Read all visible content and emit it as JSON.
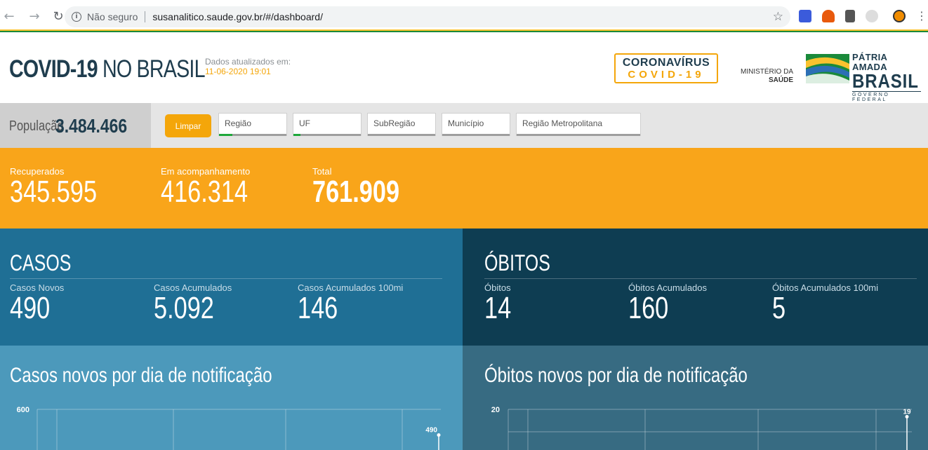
{
  "browser": {
    "security_label": "Não seguro",
    "url": "susanalitico.saude.gov.br/#/dashboard/",
    "icons": [
      "back-arrow-icon",
      "forward-arrow-icon",
      "reload-icon",
      "info-icon",
      "star-icon",
      "menu-icon"
    ]
  },
  "header": {
    "title_bold": "COVID-19",
    "title_rest": " NO BRASIL",
    "updated_label": "Dados atualizados em:",
    "updated_date": "11-06-2020 19:01",
    "covid_logo_line1": "CORONAVÍRUS",
    "covid_logo_line2": "COVID-19",
    "ministerio_line1": "MINISTÉRIO DA",
    "ministerio_line2": "SAÚDE",
    "patria_line1": "PÁTRIA AMADA",
    "patria_line2": "BRASIL",
    "patria_line3": "GOVERNO FEDERAL"
  },
  "filters": {
    "population_label": "População",
    "population_value": "3.484.466",
    "clear_label": "Limpar",
    "items": [
      {
        "label": "Região",
        "selected_fraction": 0.2
      },
      {
        "label": "UF",
        "selected_fraction": 0.1
      },
      {
        "label": "SubRegião",
        "selected_fraction": 0
      },
      {
        "label": "Município",
        "selected_fraction": 0
      },
      {
        "label": "Região Metropolitana",
        "selected_fraction": 0
      }
    ]
  },
  "summary": {
    "recuperados_label": "Recuperados",
    "recuperados_value": "345.595",
    "acompanhamento_label": "Em acompanhamento",
    "acompanhamento_value": "416.314",
    "total_label": "Total",
    "total_value": "761.909"
  },
  "casos": {
    "title": "CASOS",
    "novos_label": "Casos Novos",
    "novos_value": "490",
    "acumulados_label": "Casos Acumulados",
    "acumulados_value": "5.092",
    "acumulados100_label": "Casos Acumulados 100mi",
    "acumulados100_value": "146"
  },
  "obitos": {
    "title": "ÓBITOS",
    "novos_label": "Óbitos",
    "novos_value": "14",
    "acumulados_label": "Óbitos Acumulados",
    "acumulados_value": "160",
    "acumulados100_label": "Óbitos Acumulados 100mi",
    "acumulados100_value": "5"
  },
  "charts": {
    "casos_title": "Casos novos por dia de notificação",
    "obitos_title": "Óbitos novos por dia de notificação"
  },
  "chart_data": [
    {
      "type": "line",
      "title": "Casos novos por dia de notificação",
      "ytick_top": "600",
      "ylim": [
        0,
        600
      ],
      "points": [
        {
          "label": "490",
          "y": 490
        }
      ]
    },
    {
      "type": "line",
      "title": "Óbitos novos por dia de notificação",
      "ytick_top": "20",
      "ylim": [
        0,
        20
      ],
      "points": [
        {
          "label": "19",
          "y": 19
        }
      ]
    }
  ]
}
